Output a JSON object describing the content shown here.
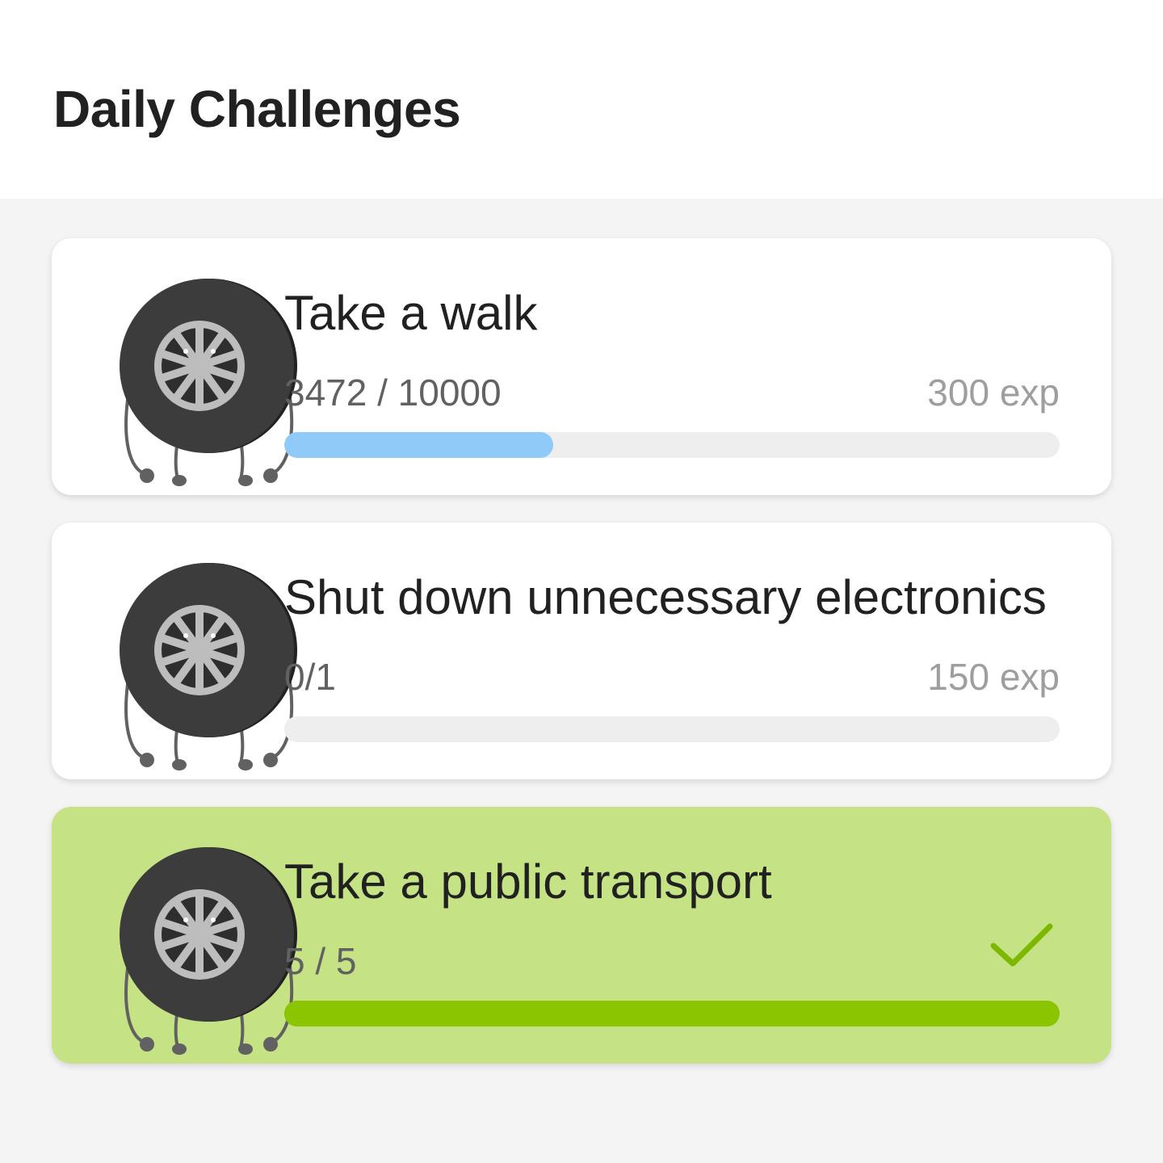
{
  "header": {
    "title": "Daily Challenges"
  },
  "colors": {
    "progress_fill": "#90caf9",
    "progress_track": "#eeeeee",
    "completed_card": "#c5e384",
    "completed_fill": "#8bc400",
    "check": "#7cb800"
  },
  "challenges": [
    {
      "title": "Take a walk",
      "progress_text": "3472 / 10000",
      "reward": "300 exp",
      "progress": 0.3472,
      "completed": false,
      "icon": "tire-mascot-icon"
    },
    {
      "title": "Shut down unnecessary electronics",
      "progress_text": "0/1",
      "reward": "150 exp",
      "progress": 0,
      "completed": false,
      "icon": "tire-mascot-icon"
    },
    {
      "title": "Take a public transport",
      "progress_text": "5 / 5",
      "reward": "",
      "progress": 1,
      "completed": true,
      "icon": "tire-mascot-icon",
      "status_icon": "checkmark-icon"
    }
  ]
}
